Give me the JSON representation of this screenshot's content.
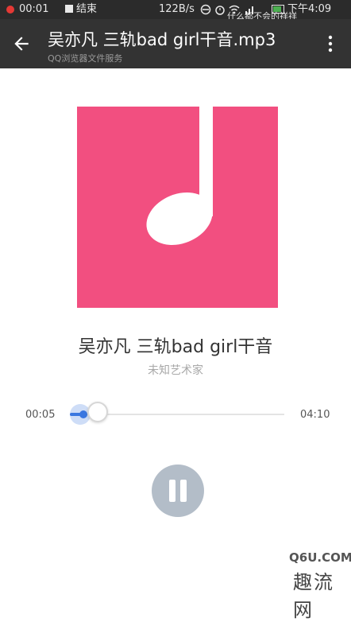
{
  "status_bar": {
    "time": "00:01",
    "end_label": "结束",
    "net_speed": "122B/s",
    "clock": "下午4:09",
    "overlay_caption": "什么都不会的祥祥",
    "colors": {
      "recording_dot": "#e53935",
      "battery": "#4caf50"
    }
  },
  "toolbar": {
    "title": "吴亦凡 三轨bad girl干音.mp3",
    "subtitle": "QQ浏览器文件服务",
    "back_icon": "arrow-left-icon",
    "menu_icon": "more-vertical-icon"
  },
  "player": {
    "album_art_color": "#f24f80",
    "album_art_icon": "music-note-icon",
    "song_title": "吴亦凡 三轨bad girl干音",
    "artist": "未知艺术家",
    "current_time": "00:05",
    "total_time": "04:10",
    "progress_fraction": 0.02,
    "state": "playing",
    "pause_icon": "pause-icon",
    "accent_color": "#3a77e0"
  },
  "watermark": {
    "line1": "Q6U.COM",
    "line2": "趣流网"
  }
}
